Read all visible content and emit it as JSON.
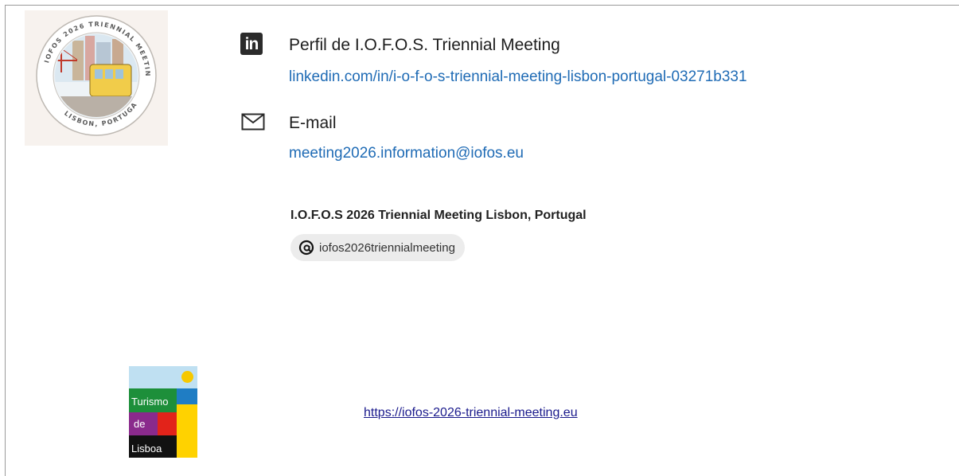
{
  "meeting_logo": {
    "text_top": "IOFOS 2026 TRIENNIAL MEETING",
    "text_bottom": "LISBON, PORTUGAL"
  },
  "linkedin": {
    "icon": "linkedin-icon",
    "icon_text": "in",
    "title": "Perfil de I.O.F.O.S. Triennial Meeting",
    "url": "linkedin.com/in/i-o-f-o-s-triennial-meeting-lisbon-portugal-03271b331"
  },
  "email": {
    "icon": "mail-icon",
    "title": "E-mail",
    "address": "meeting2026.information@iofos.eu"
  },
  "threads": {
    "heading": "I.O.F.O.S 2026 Triennial Meeting Lisbon, Portugal",
    "icon": "threads-icon",
    "handle": "iofos2026triennialmeeting"
  },
  "turismo_logo": {
    "line1": "Turismo",
    "line2": "de",
    "line3": "Lisboa"
  },
  "website": {
    "url": "https://iofos-2026-triennial-meeting.eu"
  },
  "colors": {
    "link": "#1f6bb5",
    "site_link": "#1a1a8c",
    "tl_sky": "#bfe0f2",
    "tl_sun": "#f6c800",
    "tl_blue": "#1f7dc4",
    "tl_green": "#1d8f3a",
    "tl_red": "#e2231a",
    "tl_purple": "#8a2a8c",
    "tl_yellow": "#ffd200",
    "tl_black": "#111111"
  }
}
